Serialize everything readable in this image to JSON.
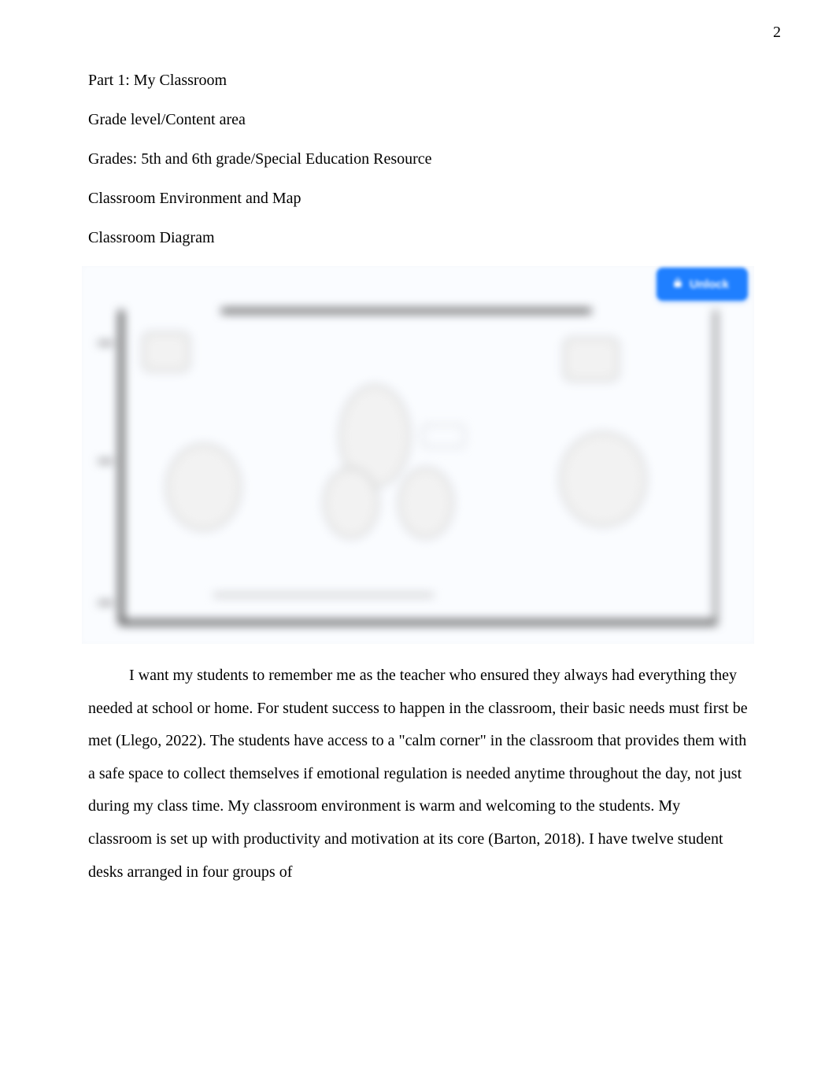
{
  "page_number": "2",
  "headings": {
    "part": "Part 1: My Classroom",
    "grade_label": "Grade level/Content area",
    "grade_value": "Grades: 5th and 6th grade/Special Education Resource",
    "env_map": "Classroom Environment and Map",
    "diagram": "Classroom Diagram"
  },
  "unlock_button": {
    "label": "Unlock"
  },
  "body_paragraph": "I want my students to remember me as the teacher who ensured they always had everything they needed at school or home. For student success to happen in the classroom, their basic needs must first be met (Llego, 2022). The students have access to a \"calm corner\" in the classroom that provides them with a safe space to collect themselves if emotional regulation is needed anytime throughout the day, not just during my class time. My classroom environment is warm and welcoming to the students. My classroom is set up with productivity and motivation at its core (Barton, 2018). I have twelve student desks arranged in four groups of"
}
